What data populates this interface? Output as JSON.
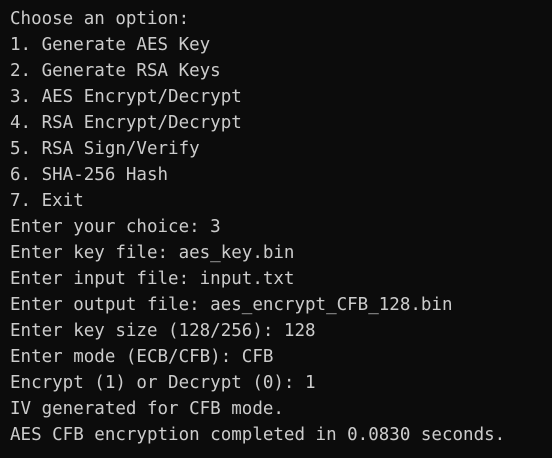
{
  "terminal": {
    "lines": [
      "Choose an option:",
      "1. Generate AES Key",
      "2. Generate RSA Keys",
      "3. AES Encrypt/Decrypt",
      "4. RSA Encrypt/Decrypt",
      "5. RSA Sign/Verify",
      "6. SHA-256 Hash",
      "7. Exit",
      "Enter your choice: 3",
      "Enter key file: aes_key.bin",
      "Enter input file: input.txt",
      "Enter output file: aes_encrypt_CFB_128.bin",
      "Enter key size (128/256): 128",
      "Enter mode (ECB/CFB): CFB",
      "Encrypt (1) or Decrypt (0): 1",
      "IV generated for CFB mode.",
      "AES CFB encryption completed in 0.0830 seconds."
    ]
  }
}
